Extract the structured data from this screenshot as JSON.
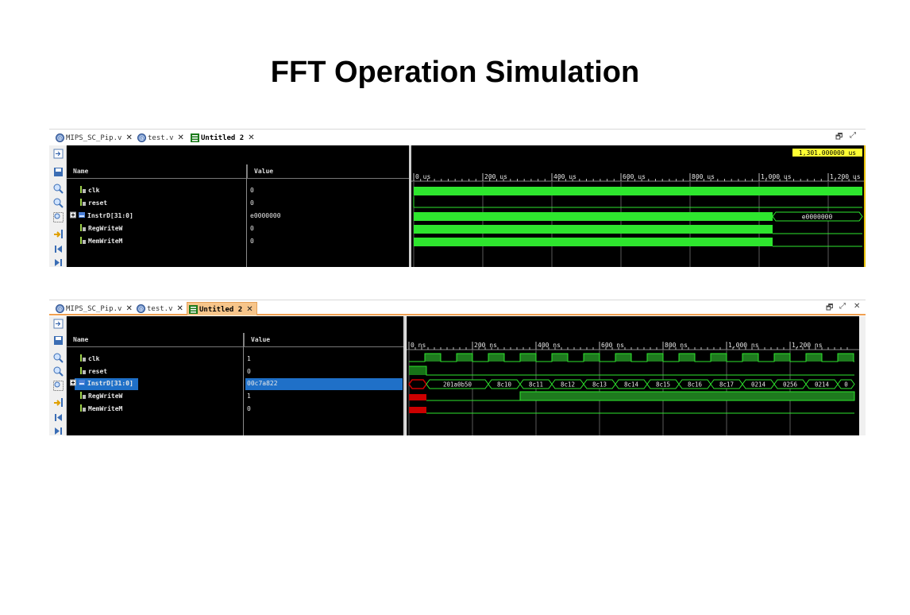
{
  "title": "FFT Operation Simulation",
  "panels": [
    {
      "tabs": [
        "MIPS_SC_Pip.v",
        "test.v",
        "Untitled 2"
      ],
      "name_header": "Name",
      "value_header": "Value",
      "cursor_value": "1,301.000000 us",
      "time_ticks": [
        "0 us",
        "200 us",
        "400 us",
        "600 us",
        "800 us",
        "1,000 us",
        "1,200 us"
      ],
      "signals": [
        {
          "name": "clk",
          "value": "0"
        },
        {
          "name": "reset",
          "value": "0"
        },
        {
          "name": "InstrD[31:0]",
          "value": "e0000000",
          "bus": true
        },
        {
          "name": "RegWriteW",
          "value": "0"
        },
        {
          "name": "MemWriteM",
          "value": "0"
        }
      ],
      "bus_labels": [
        "e0000000"
      ]
    },
    {
      "tabs": [
        "MIPS_SC_Pip.v",
        "test.v",
        "Untitled 2"
      ],
      "name_header": "Name",
      "value_header": "Value",
      "time_ticks": [
        "0 ns",
        "200 ns",
        "400 ns",
        "600 ns",
        "800 ns",
        "1,000 ns",
        "1,200 ns"
      ],
      "signals": [
        {
          "name": "clk",
          "value": "1"
        },
        {
          "name": "reset",
          "value": "0"
        },
        {
          "name": "InstrD[31:0]",
          "value": "00c7a822",
          "bus": true,
          "selected": true
        },
        {
          "name": "RegWriteW",
          "value": "1"
        },
        {
          "name": "MemWriteM",
          "value": "0"
        }
      ],
      "bus_labels": [
        "201a0b50",
        "8c10",
        "8c11",
        "8c12",
        "8c13",
        "8c14",
        "8c15",
        "8c16",
        "8c17",
        "0214",
        "0256",
        "0214",
        "0"
      ]
    }
  ],
  "colors": {
    "wave": "#2ee62e",
    "grid": "#5a5a5a",
    "cursor_bg": "#ffff33",
    "selection": "#1f70c8",
    "reset_red": "#cc0000"
  },
  "icons": [
    "verilog-file-icon",
    "waveform-icon",
    "zoom-in-icon",
    "zoom-out-icon",
    "zoom-fit-icon",
    "go-to-cursor-icon",
    "go-to-start-icon",
    "go-to-end-icon",
    "expand-icon",
    "bus-icon",
    "signal-icon"
  ]
}
